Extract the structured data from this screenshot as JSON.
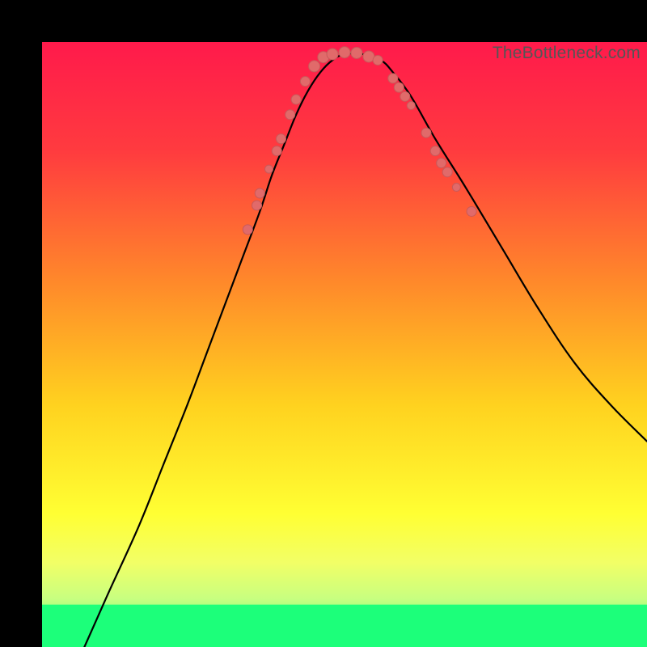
{
  "watermark": "TheBottleneck.com",
  "chart_data": {
    "type": "line",
    "title": "",
    "xlabel": "",
    "ylabel": "",
    "xlim": [
      0,
      100
    ],
    "ylim": [
      0,
      100
    ],
    "gradient_stops": [
      {
        "offset": 0,
        "color": "#ff1a4b"
      },
      {
        "offset": 18,
        "color": "#ff3b3f"
      },
      {
        "offset": 40,
        "color": "#ff8a2a"
      },
      {
        "offset": 60,
        "color": "#ffd21f"
      },
      {
        "offset": 78,
        "color": "#ffff33"
      },
      {
        "offset": 86,
        "color": "#f2ff66"
      },
      {
        "offset": 92,
        "color": "#c8ff80"
      },
      {
        "offset": 100,
        "color": "#1cff7a"
      }
    ],
    "bottom_band": {
      "from_y": 93,
      "to_y": 100,
      "color": "#1cff7a"
    },
    "series": [
      {
        "name": "bottleneck-curve",
        "x": [
          7,
          11,
          16,
          20,
          24,
          27,
          30,
          33,
          36,
          38,
          40,
          42,
          44,
          46,
          48,
          50,
          53,
          56,
          58,
          61,
          65,
          70,
          76,
          82,
          88,
          94,
          100
        ],
        "y": [
          0,
          9,
          20,
          30,
          40,
          48,
          56,
          64,
          72,
          78,
          83,
          88,
          92,
          95,
          97,
          98,
          98,
          97,
          95,
          91,
          84,
          76,
          66,
          56,
          47,
          40,
          34
        ]
      }
    ],
    "markers": {
      "color": "#e16a6a",
      "stroke": "#c85a5a",
      "points": [
        {
          "x": 34.0,
          "y": 69.0,
          "r": 6
        },
        {
          "x": 35.5,
          "y": 73.0,
          "r": 6
        },
        {
          "x": 36.0,
          "y": 75.0,
          "r": 6
        },
        {
          "x": 37.5,
          "y": 79.0,
          "r": 5
        },
        {
          "x": 38.8,
          "y": 82.0,
          "r": 6
        },
        {
          "x": 39.5,
          "y": 84.0,
          "r": 6
        },
        {
          "x": 41.0,
          "y": 88.0,
          "r": 6
        },
        {
          "x": 42.0,
          "y": 90.5,
          "r": 6
        },
        {
          "x": 43.5,
          "y": 93.5,
          "r": 6
        },
        {
          "x": 45.0,
          "y": 96.0,
          "r": 7
        },
        {
          "x": 46.5,
          "y": 97.5,
          "r": 7
        },
        {
          "x": 48.0,
          "y": 98.0,
          "r": 7
        },
        {
          "x": 50.0,
          "y": 98.3,
          "r": 7
        },
        {
          "x": 52.0,
          "y": 98.2,
          "r": 7
        },
        {
          "x": 54.0,
          "y": 97.6,
          "r": 7
        },
        {
          "x": 55.5,
          "y": 97.0,
          "r": 6
        },
        {
          "x": 58.0,
          "y": 94.0,
          "r": 6
        },
        {
          "x": 59.0,
          "y": 92.5,
          "r": 6
        },
        {
          "x": 60.0,
          "y": 91.0,
          "r": 6
        },
        {
          "x": 61.0,
          "y": 89.5,
          "r": 5
        },
        {
          "x": 63.5,
          "y": 85.0,
          "r": 6
        },
        {
          "x": 65.0,
          "y": 82.0,
          "r": 6
        },
        {
          "x": 66.0,
          "y": 80.0,
          "r": 6
        },
        {
          "x": 67.0,
          "y": 78.5,
          "r": 6
        },
        {
          "x": 68.5,
          "y": 76.0,
          "r": 5
        },
        {
          "x": 71.0,
          "y": 72.0,
          "r": 6
        }
      ]
    }
  }
}
